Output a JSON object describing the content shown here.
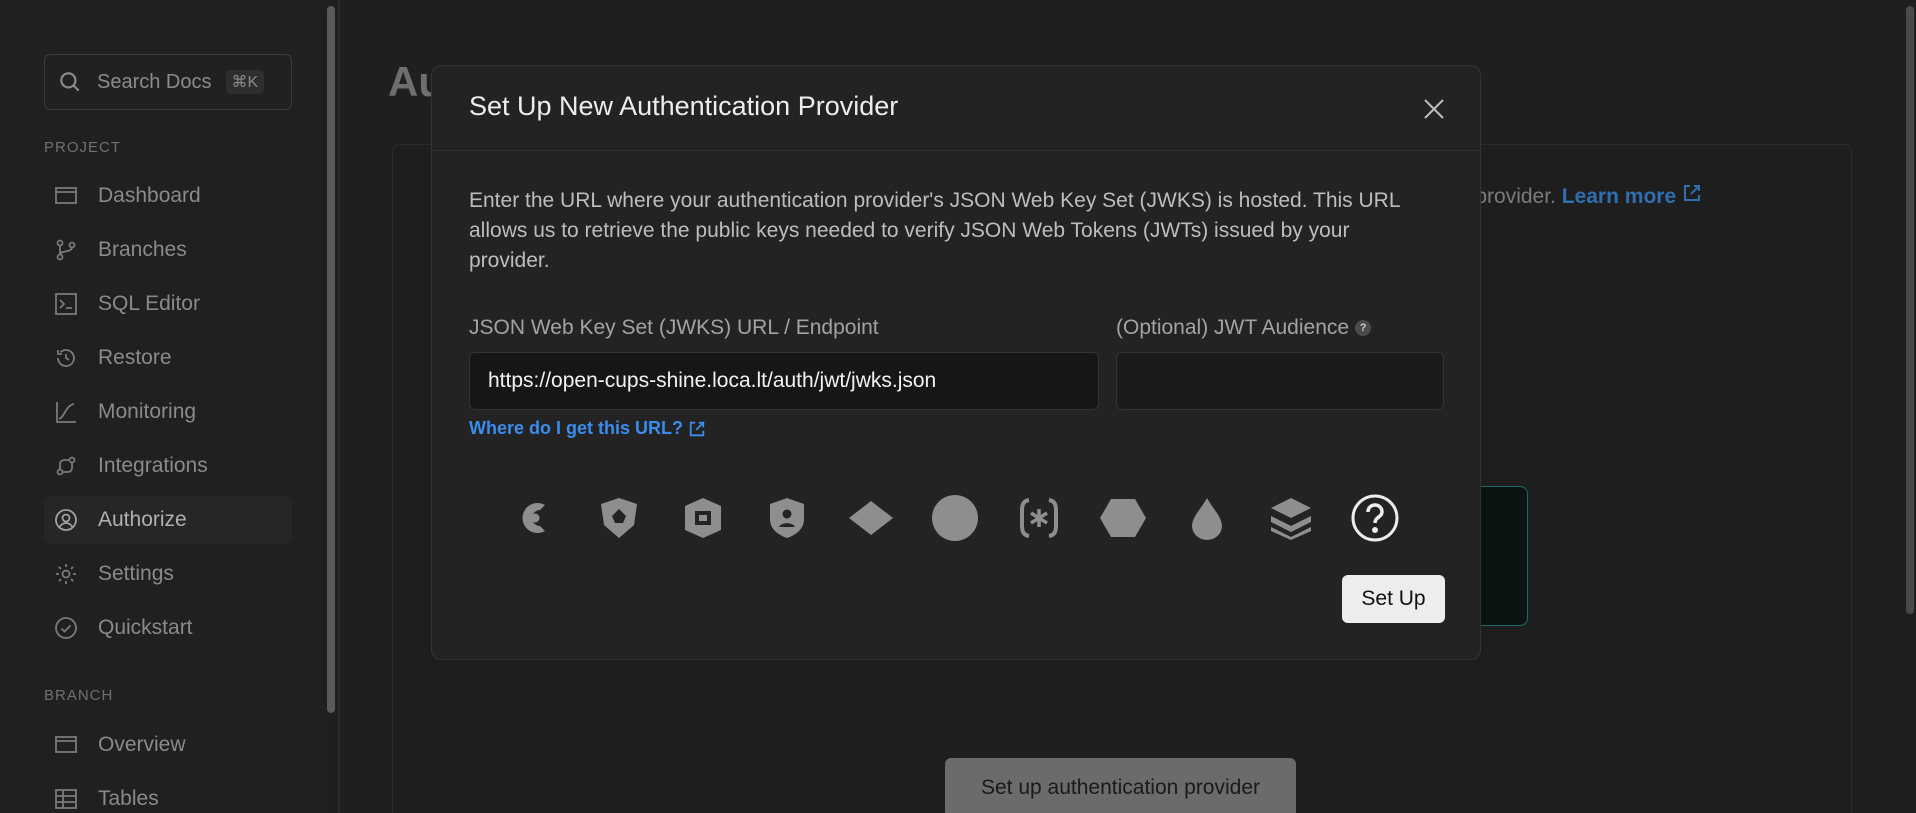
{
  "sidebar": {
    "search_placeholder": "Search Docs",
    "search_shortcut": "⌘K",
    "project_label": "PROJECT",
    "project_items": [
      {
        "label": "Dashboard",
        "icon": "dashboard-icon"
      },
      {
        "label": "Branches",
        "icon": "branches-icon"
      },
      {
        "label": "SQL Editor",
        "icon": "sql-editor-icon"
      },
      {
        "label": "Restore",
        "icon": "restore-icon"
      },
      {
        "label": "Monitoring",
        "icon": "monitoring-icon"
      },
      {
        "label": "Integrations",
        "icon": "integrations-icon"
      },
      {
        "label": "Authorize",
        "icon": "authorize-icon",
        "active": true
      },
      {
        "label": "Settings",
        "icon": "settings-icon"
      },
      {
        "label": "Quickstart",
        "icon": "quickstart-icon"
      }
    ],
    "branch_label": "BRANCH",
    "branch_items": [
      {
        "label": "Overview",
        "icon": "overview-icon"
      },
      {
        "label": "Tables",
        "icon": "tables-icon"
      }
    ]
  },
  "main": {
    "title_fragment": "Au",
    "description_fragment": "th provider.",
    "learn_more": "Learn more",
    "bg_button": "Set up authentication provider"
  },
  "modal": {
    "title": "Set Up New Authentication Provider",
    "description": "Enter the URL where your authentication provider's JSON Web Key Set (JWKS) is hosted. This URL allows us to retrieve the public keys needed to verify JSON Web Tokens (JWTs) issued by your provider.",
    "jwks_label": "JSON Web Key Set (JWKS) URL / Endpoint",
    "jwks_value": "https://open-cups-shine.loca.lt/auth/jwt/jwks.json",
    "audience_label": "(Optional) JWT Audience",
    "audience_help": "?",
    "audience_value": "",
    "where_link": "Where do I get this URL?",
    "providers": [
      "clerk-icon",
      "auth0-icon",
      "stack-auth-icon",
      "shield-user-icon",
      "diamond-icon",
      "circle-icon",
      "bracket-asterisk-icon",
      "hexagon-icon",
      "drop-icon",
      "layers-icon",
      "other-provider-icon"
    ],
    "submit_label": "Set Up"
  },
  "colors": {
    "link": "#3b8ded",
    "modal_bg": "#232323",
    "accent_teal": "#1e6b66"
  }
}
